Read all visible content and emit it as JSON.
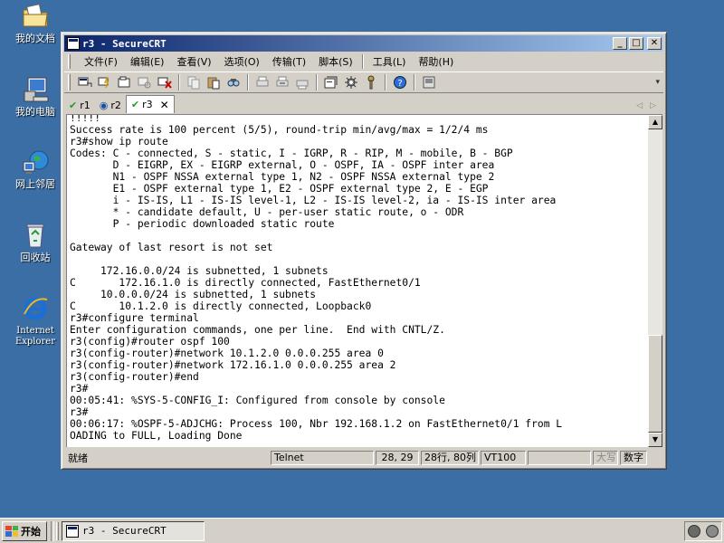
{
  "desktop": {
    "icons": [
      {
        "label": "我的文档",
        "icon": "folder-documents-icon"
      },
      {
        "label": "我的电脑",
        "icon": "computer-icon"
      },
      {
        "label": "网上邻居",
        "icon": "network-icon"
      },
      {
        "label": "回收站",
        "icon": "recycle-bin-icon"
      },
      {
        "label": "Internet Explorer",
        "icon": "internet-explorer-icon"
      }
    ]
  },
  "window": {
    "title": "r3 - SecureCRT",
    "controls": {
      "minimize": "_",
      "maximize": "□",
      "close": "✕"
    }
  },
  "menu": {
    "items": [
      "文件(F)",
      "编辑(E)",
      "查看(V)",
      "选项(O)",
      "传输(T)",
      "脚本(S)",
      "工具(L)",
      "帮助(H)"
    ]
  },
  "toolbar": {
    "icons": [
      "connect-icon",
      "quick-connect-icon",
      "connect-tab-icon",
      "reconnect-icon",
      "disconnect-icon",
      "copy-icon",
      "paste-icon",
      "find-icon",
      "print-icon",
      "print-selection-icon",
      "print-screen-icon",
      "session-options-icon",
      "global-options-icon",
      "keymap-icon",
      "help-icon",
      "about-icon"
    ]
  },
  "tabs": [
    {
      "label": "r1",
      "status": "connected"
    },
    {
      "label": "r2",
      "status": "info"
    },
    {
      "label": "r3",
      "status": "connected",
      "active": true,
      "close": "✕"
    }
  ],
  "terminal": {
    "lines": [
      "!!!!!",
      "Success rate is 100 percent (5/5), round-trip min/avg/max = 1/2/4 ms",
      "r3#show ip route",
      "Codes: C - connected, S - static, I - IGRP, R - RIP, M - mobile, B - BGP",
      "       D - EIGRP, EX - EIGRP external, O - OSPF, IA - OSPF inter area",
      "       N1 - OSPF NSSA external type 1, N2 - OSPF NSSA external type 2",
      "       E1 - OSPF external type 1, E2 - OSPF external type 2, E - EGP",
      "       i - IS-IS, L1 - IS-IS level-1, L2 - IS-IS level-2, ia - IS-IS inter area",
      "       * - candidate default, U - per-user static route, o - ODR",
      "       P - periodic downloaded static route",
      "",
      "Gateway of last resort is not set",
      "",
      "     172.16.0.0/24 is subnetted, 1 subnets",
      "C       172.16.1.0 is directly connected, FastEthernet0/1",
      "     10.0.0.0/24 is subnetted, 1 subnets",
      "C       10.1.2.0 is directly connected, Loopback0",
      "r3#configure terminal",
      "Enter configuration commands, one per line.  End with CNTL/Z.",
      "r3(config)#router ospf 100",
      "r3(config-router)#network 10.1.2.0 0.0.0.255 area 0",
      "r3(config-router)#network 172.16.1.0 0.0.0.255 area 2",
      "r3(config-router)#end",
      "r3#",
      "00:05:41: %SYS-5-CONFIG_I: Configured from console by console",
      "r3#",
      "00:06:17: %OSPF-5-ADJCHG: Process 100, Nbr 192.168.1.2 on FastEthernet0/1 from L",
      "OADING to FULL, Loading Done"
    ]
  },
  "statusbar": {
    "ready": "就绪",
    "protocol": "Telnet",
    "cursor": "28, 29",
    "size": "28行, 80列",
    "emulation": "VT100",
    "caps": "大写",
    "num": "数字"
  },
  "taskbar": {
    "start": "开始",
    "task": "r3 - SecureCRT"
  }
}
